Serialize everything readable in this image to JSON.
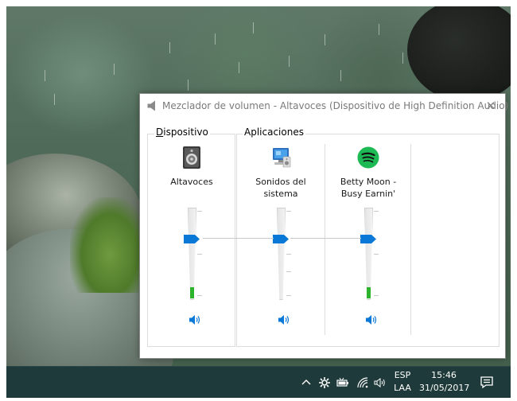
{
  "window": {
    "title": "Mezclador de volumen - Altavoces (Dispositivo de High Definition Audio)",
    "close_glyph": "✕"
  },
  "groups": {
    "device_label_accel": "D",
    "device_label_rest": "ispositivo",
    "apps_label": "Aplicaciones"
  },
  "channels": [
    {
      "label": "Altavoces",
      "icon": "speaker-device-icon",
      "volume_fraction": 0.7,
      "level_fraction": 0.12
    },
    {
      "label": "Sonidos del\nsistema",
      "icon": "system-sounds-icon",
      "volume_fraction": 0.7,
      "level_fraction": 0
    },
    {
      "label": "Betty Moon -\nBusy Earnin'",
      "icon": "spotify-icon",
      "volume_fraction": 0.7,
      "level_fraction": 0.12
    }
  ],
  "taskbar": {
    "language_line1": "ESP",
    "language_line2": "LAA",
    "time": "15:46",
    "date": "31/05/2017"
  },
  "colors": {
    "accent": "#0a78d7",
    "level": "#2cb52c",
    "taskbar": "#1f3a3a",
    "spotify": "#1db954"
  }
}
